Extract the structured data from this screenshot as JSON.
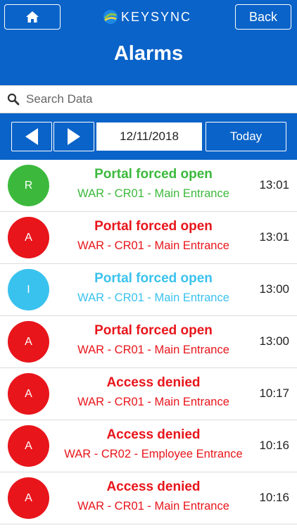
{
  "header": {
    "home_icon": "home-icon",
    "logo_text": "KEYSYNC",
    "back_label": "Back",
    "title": "Alarms"
  },
  "search": {
    "placeholder": "Search Data",
    "value": ""
  },
  "date_nav": {
    "prev_icon": "triangle-left-icon",
    "next_icon": "triangle-right-icon",
    "date": "12/11/2018",
    "today_label": "Today"
  },
  "colors": {
    "brand_blue": "#0a63c8",
    "green": "#3cb93c",
    "red": "#e8151b",
    "cyan": "#3ac2ee"
  },
  "alarms": [
    {
      "badge": "R",
      "title": "Portal forced open",
      "location": "WAR - CR01 - Main Entrance",
      "time": "13:01",
      "color": "#3cb93c"
    },
    {
      "badge": "A",
      "title": "Portal forced open",
      "location": "WAR - CR01 - Main Entrance",
      "time": "13:01",
      "color": "#e8151b"
    },
    {
      "badge": "I",
      "title": "Portal forced open",
      "location": "WAR - CR01 - Main Entrance",
      "time": "13:00",
      "color": "#3ac2ee"
    },
    {
      "badge": "A",
      "title": "Portal forced open",
      "location": "WAR - CR01 - Main Entrance",
      "time": "13:00",
      "color": "#e8151b"
    },
    {
      "badge": "A",
      "title": "Access denied",
      "location": "WAR - CR01 - Main Entrance",
      "time": "10:17",
      "color": "#e8151b"
    },
    {
      "badge": "A",
      "title": "Access denied",
      "location": "WAR - CR02 - Employee Entrance",
      "time": "10:16",
      "color": "#e8151b"
    },
    {
      "badge": "A",
      "title": "Access denied",
      "location": "WAR - CR01 - Main Entrance",
      "time": "10:16",
      "color": "#e8151b"
    }
  ]
}
